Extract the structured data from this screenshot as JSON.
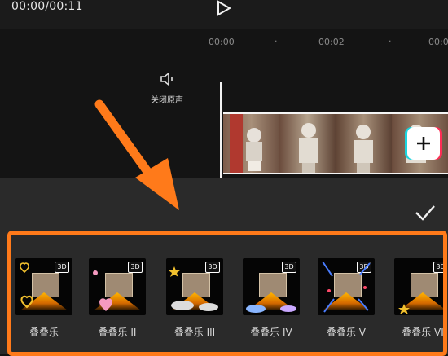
{
  "time": "00:00/00:11",
  "ruler": {
    "ticks": [
      "00:00",
      "00:02",
      "00:0"
    ]
  },
  "audio": {
    "mute_label": "关闭原声"
  },
  "effects": [
    {
      "label": "叠叠乐"
    },
    {
      "label": "叠叠乐 II"
    },
    {
      "label": "叠叠乐 III"
    },
    {
      "label": "叠叠乐 IV"
    },
    {
      "label": "叠叠乐 V"
    },
    {
      "label": "叠叠乐 VI"
    }
  ],
  "badge_text": "3D",
  "colors": {
    "highlight": "#ff7a1a",
    "arrow": "#ff7a1a"
  }
}
